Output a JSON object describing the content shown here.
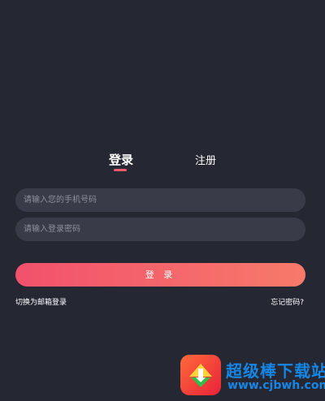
{
  "tabs": {
    "login": "登录",
    "register": "注册"
  },
  "form": {
    "phone_placeholder": "请输入您的手机号码",
    "password_placeholder": "请输入登录密码",
    "submit_label": "登 录"
  },
  "links": {
    "email_login": "切换为邮箱登录",
    "forgot_password": "忘记密码?"
  },
  "watermark": {
    "site_name": "超级棒下载站",
    "url": "www.cjbwh.com"
  },
  "colors": {
    "background": "#252833",
    "field": "#393c48",
    "accent_start": "#f2516c",
    "accent_end": "#f77a6a",
    "watermark": "#1686e6"
  }
}
